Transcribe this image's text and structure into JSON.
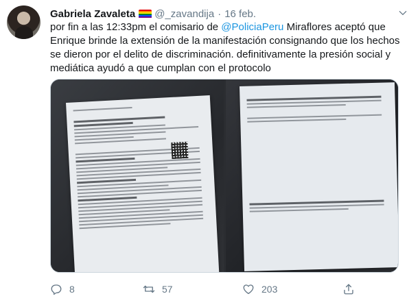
{
  "tweet": {
    "display_name": "Gabriela Zavaleta",
    "handle": "@_zavandija",
    "separator": "·",
    "date": "16 feb.",
    "text_before_mention": "por fin a las 12:33pm el comisario de ",
    "mention": "@PoliciaPeru",
    "text_after_mention": " Miraflores aceptó que Enrique brinde la extensión de la manifestación consignando que los hechos se dieron por el delito de discriminación. definitivamente la presión social y mediática ayudó a que cumplan con el protocolo"
  },
  "flag_colors": [
    "#e40303",
    "#ff8c00",
    "#ffed00",
    "#008026",
    "#004dff",
    "#750787"
  ],
  "icons": {
    "more": "chevron-down-icon",
    "reply": "reply-icon",
    "retweet": "retweet-icon",
    "like": "heart-icon",
    "share": "share-icon"
  },
  "actions": {
    "reply_count": "8",
    "retweet_count": "57",
    "like_count": "203"
  },
  "colors": {
    "link": "#1b95e0",
    "secondary_text": "#657786",
    "primary_text": "#14171a"
  }
}
